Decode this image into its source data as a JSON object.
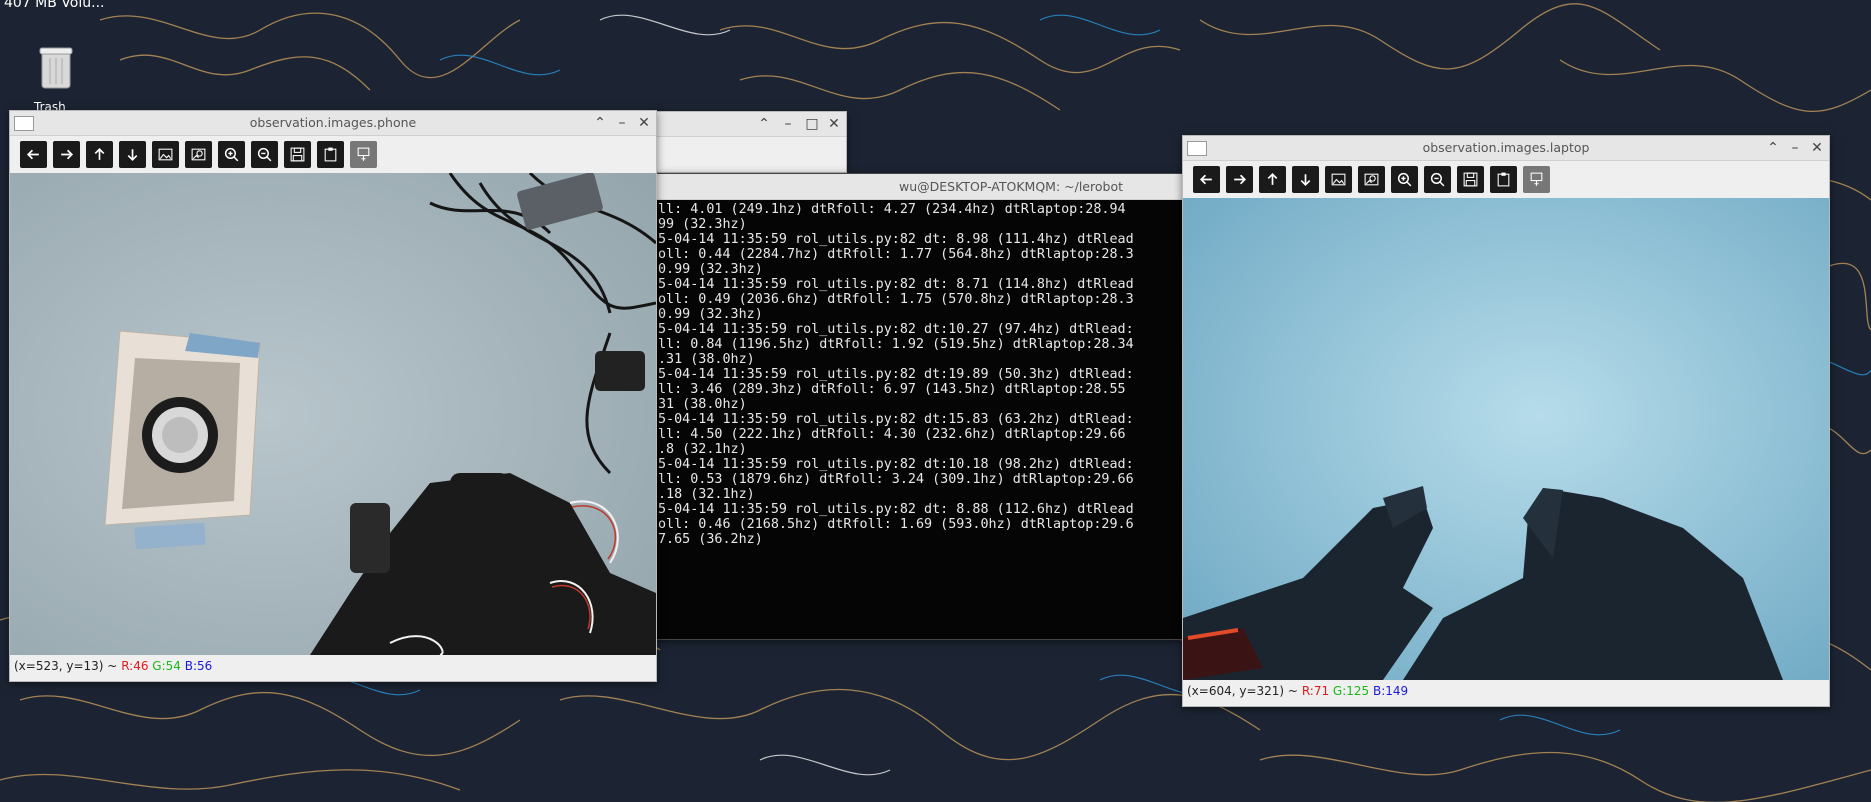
{
  "desktop": {
    "top_text": "407 MB Volu...",
    "trash_label": "Trash"
  },
  "colors": {
    "desktop_bg": "#1c2433",
    "window_chrome": "#efefef",
    "terminal_bg": "#050505",
    "red": "#e41a1a",
    "green": "#1ab81a",
    "blue": "#1a1ad8"
  },
  "phone_window": {
    "title": "observation.images.phone",
    "status_coord": "(x=523, y=13) ~",
    "status_r": "R:46",
    "status_g": "G:54",
    "status_b": "B:56"
  },
  "laptop_window": {
    "title": "observation.images.laptop",
    "status_coord": "(x=604, y=321) ~",
    "status_r": "R:71",
    "status_g": "G:125",
    "status_b": "B:149"
  },
  "terminal": {
    "title": "wu@DESKTOP-ATOKMQM: ~/lerobot",
    "lines": [
      "ll: 4.01 (249.1hz) dtRfoll: 4.27 (234.4hz) dtRlaptop:28.94",
      "99 (32.3hz)",
      "5-04-14 11:35:59 rol_utils.py:82 dt: 8.98 (111.4hz) dtRlead",
      "oll: 0.44 (2284.7hz) dtRfoll: 1.77 (564.8hz) dtRlaptop:28.3",
      "0.99 (32.3hz)",
      "5-04-14 11:35:59 rol_utils.py:82 dt: 8.71 (114.8hz) dtRlead",
      "oll: 0.49 (2036.6hz) dtRfoll: 1.75 (570.8hz) dtRlaptop:28.3",
      "0.99 (32.3hz)",
      "5-04-14 11:35:59 rol_utils.py:82 dt:10.27 (97.4hz) dtRlead:",
      "ll: 0.84 (1196.5hz) dtRfoll: 1.92 (519.5hz) dtRlaptop:28.34",
      ".31 (38.0hz)",
      "5-04-14 11:35:59 rol_utils.py:82 dt:19.89 (50.3hz) dtRlead:",
      "ll: 3.46 (289.3hz) dtRfoll: 6.97 (143.5hz) dtRlaptop:28.55",
      "31 (38.0hz)",
      "5-04-14 11:35:59 rol_utils.py:82 dt:15.83 (63.2hz) dtRlead:",
      "ll: 4.50 (222.1hz) dtRfoll: 4.30 (232.6hz) dtRlaptop:29.66",
      ".8 (32.1hz)",
      "5-04-14 11:35:59 rol_utils.py:82 dt:10.18 (98.2hz) dtRlead:",
      "ll: 0.53 (1879.6hz) dtRfoll: 3.24 (309.1hz) dtRlaptop:29.66",
      ".18 (32.1hz)",
      "5-04-14 11:35:59 rol_utils.py:82 dt: 8.88 (112.6hz) dtRlead",
      "oll: 0.46 (2168.5hz) dtRfoll: 1.69 (593.0hz) dtRlaptop:29.6",
      "7.65 (36.2hz)"
    ]
  },
  "toolbar_icons": [
    "arrow-left-icon",
    "arrow-right-icon",
    "arrow-up-icon",
    "arrow-down-icon",
    "image-icon",
    "image-properties-icon",
    "zoom-in-icon",
    "zoom-out-icon",
    "save-icon",
    "copy-icon",
    "settings-icon"
  ]
}
